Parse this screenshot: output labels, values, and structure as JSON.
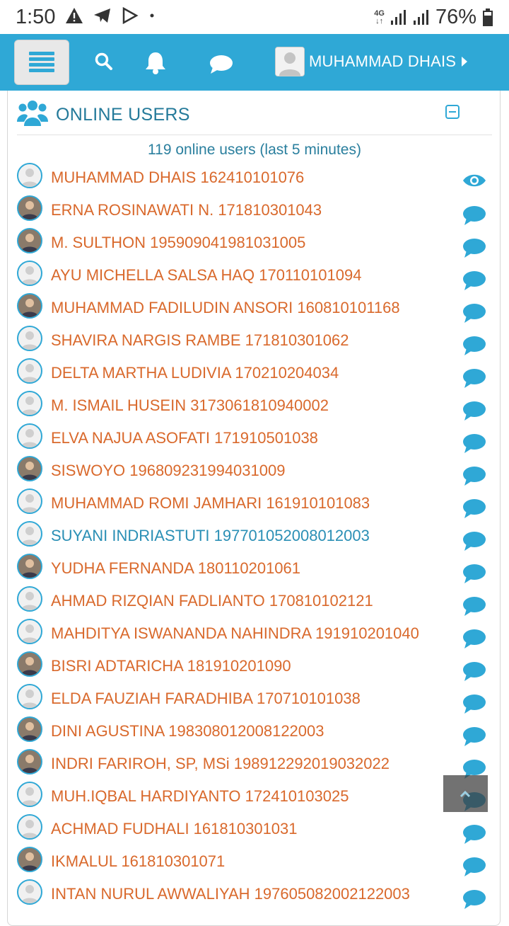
{
  "status_bar": {
    "time": "1:50",
    "network": "4G",
    "battery": "76%"
  },
  "navbar": {
    "menu_icon": "hamburger-icon",
    "search_icon": "search-icon",
    "bell_icon": "bell-icon",
    "message_icon": "chat-icon",
    "user_name": "MUHAMMAD DHAIS",
    "accent_color": "#2fa8d6"
  },
  "panel": {
    "title": "ONLINE USERS",
    "summary": "119 online users (last 5 minutes)"
  },
  "users": [
    {
      "label": "MUHAMMAD DHAIS 162410101076",
      "action": "eye-icon",
      "photo": false,
      "blue": false
    },
    {
      "label": "ERNA ROSINAWATI N. 171810301043",
      "action": "chat-icon",
      "photo": true,
      "blue": false
    },
    {
      "label": "M. SULTHON 195909041981031005",
      "action": "chat-icon",
      "photo": true,
      "blue": false
    },
    {
      "label": "AYU MICHELLA SALSA HAQ 170110101094",
      "action": "chat-icon",
      "photo": false,
      "blue": false
    },
    {
      "label": "MUHAMMAD FADILUDIN ANSORI 160810101168",
      "action": "chat-icon",
      "photo": true,
      "blue": false
    },
    {
      "label": "SHAVIRA NARGIS RAMBE 171810301062",
      "action": "chat-icon",
      "photo": false,
      "blue": false
    },
    {
      "label": "DELTA MARTHA LUDIVIA 170210204034",
      "action": "chat-icon",
      "photo": false,
      "blue": false
    },
    {
      "label": "M. ISMAIL HUSEIN 3173061810940002",
      "action": "chat-icon",
      "photo": false,
      "blue": false
    },
    {
      "label": "ELVA NAJUA ASOFATI 171910501038",
      "action": "chat-icon",
      "photo": false,
      "blue": false
    },
    {
      "label": "SISWOYO 196809231994031009",
      "action": "chat-icon",
      "photo": true,
      "blue": false
    },
    {
      "label": "MUHAMMAD ROMI JAMHARI 161910101083",
      "action": "chat-icon",
      "photo": false,
      "blue": false
    },
    {
      "label": "SUYANI INDRIASTUTI 197701052008012003",
      "action": "chat-icon",
      "photo": false,
      "blue": true
    },
    {
      "label": "YUDHA FERNANDA 180110201061",
      "action": "chat-icon",
      "photo": true,
      "blue": false
    },
    {
      "label": "AHMAD RIZQIAN FADLIANTO 170810102121",
      "action": "chat-icon",
      "photo": false,
      "blue": false
    },
    {
      "label": "MAHDITYA ISWANANDA NAHINDRA 191910201040",
      "action": "chat-icon",
      "photo": false,
      "blue": false
    },
    {
      "label": "BISRI ADTARICHA 181910201090",
      "action": "chat-icon",
      "photo": true,
      "blue": false
    },
    {
      "label": "ELDA FAUZIAH FARADHIBA 170710101038",
      "action": "chat-icon",
      "photo": false,
      "blue": false
    },
    {
      "label": "DINI AGUSTINA 198308012008122003",
      "action": "chat-icon",
      "photo": true,
      "blue": false
    },
    {
      "label": "INDRI FARIROH, SP, MSi 198912292019032022",
      "action": "chat-icon",
      "photo": true,
      "blue": false
    },
    {
      "label": "MUH.IQBAL HARDIYANTO 172410103025",
      "action": "chat-icon",
      "photo": false,
      "blue": false
    },
    {
      "label": "ACHMAD FUDHALI 161810301031",
      "action": "chat-icon",
      "photo": false,
      "blue": false
    },
    {
      "label": "IKMALUL 161810301071",
      "action": "chat-icon",
      "photo": true,
      "blue": false
    },
    {
      "label": "INTAN NURUL AWWALIYAH 197605082002122003",
      "action": "chat-icon",
      "photo": false,
      "blue": false
    }
  ],
  "floating_button": {
    "icon": "chevron-up-icon"
  }
}
